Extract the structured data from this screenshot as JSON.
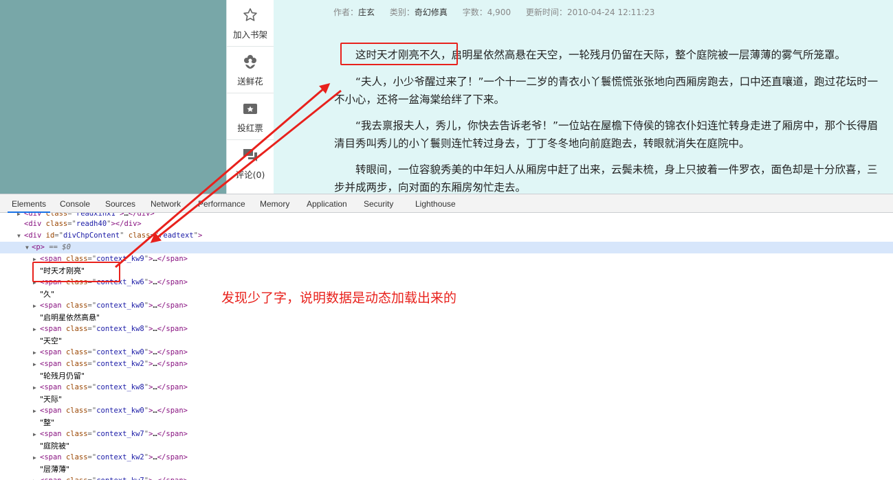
{
  "toolbar": {
    "items": [
      {
        "label": "加入书架",
        "icon": "star-icon"
      },
      {
        "label": "送鲜花",
        "icon": "flower-icon"
      },
      {
        "label": "投红票",
        "icon": "ticket-icon"
      },
      {
        "label": "评论(0)",
        "icon": "comment-icon"
      }
    ]
  },
  "book_meta": {
    "author_key": "作者：",
    "author": "庄玄",
    "category_key": "类别：",
    "category": "奇幻修真",
    "words_key": "字数：",
    "words": "4,900",
    "updated_key": "更新时间：",
    "updated": "2010-04-24 12:11:23"
  },
  "chapter": {
    "paragraphs": [
      "这时天才刚亮不久，启明星依然高悬在天空，一轮残月仍留在天际，整个庭院被一层薄薄的雾气所笼罩。",
      "“夫人，小少爷醒过来了！”一个十一二岁的青衣小丫鬟慌慌张张地向西厢房跑去，口中还直嚷道，跑过花坛时一不小心，还将一盆海棠给绊了下来。",
      "“我去禀报夫人，秀儿，你快去告诉老爷！”一位站在屋檐下侍侯的锦衣仆妇连忙转身走进了厢房中，那个长得眉清目秀叫秀儿的小丫鬟则连忙转过身去，丁丁冬冬地向前庭跑去，转眼就消失在庭院中。",
      "转眼间，一位容貌秀美的中年妇人从厢房中赶了出来，云鬓未梳，身上只披着一件罗衣，面色却是十分欣喜，三步并成两步，向对面的东厢房匆忙走去。"
    ]
  },
  "devtools": {
    "tabs": [
      "Elements",
      "Console",
      "Sources",
      "Network",
      "Performance",
      "Memory",
      "Application",
      "Security",
      "Lighthouse"
    ],
    "active_tab": "Elements",
    "lines": {
      "l0": {
        "tag": "div",
        "attr": "class",
        "val": "readxinx1"
      },
      "l1": {
        "tag": "div",
        "attr": "class",
        "val": "readh40"
      },
      "l2": {
        "tag": "div",
        "attr1": "id",
        "val1": "divChpContent",
        "attr2": "class",
        "val2": "readtext"
      },
      "l3": {
        "tag": "p",
        "marker": "== $0"
      },
      "spans": [
        "context_kw9",
        "context_kw6",
        "context_kw0",
        "context_kw8",
        "context_kw0",
        "context_kw2",
        "context_kw8",
        "context_kw0",
        "context_kw7",
        "context_kw2",
        "context_kw7"
      ],
      "texts": [
        "\"时天才刚亮\"",
        "\"久\"",
        "\"启明星依然高悬\"",
        "\"天空\"",
        "\"轮残月仍留\"",
        "\"天际\"",
        "\"整\"",
        "\"庭院被\"",
        "\"层薄薄\""
      ]
    }
  },
  "annotation": {
    "note": "发现少了字，说明数据是动态加载出来的",
    "color": "#e8211c"
  }
}
